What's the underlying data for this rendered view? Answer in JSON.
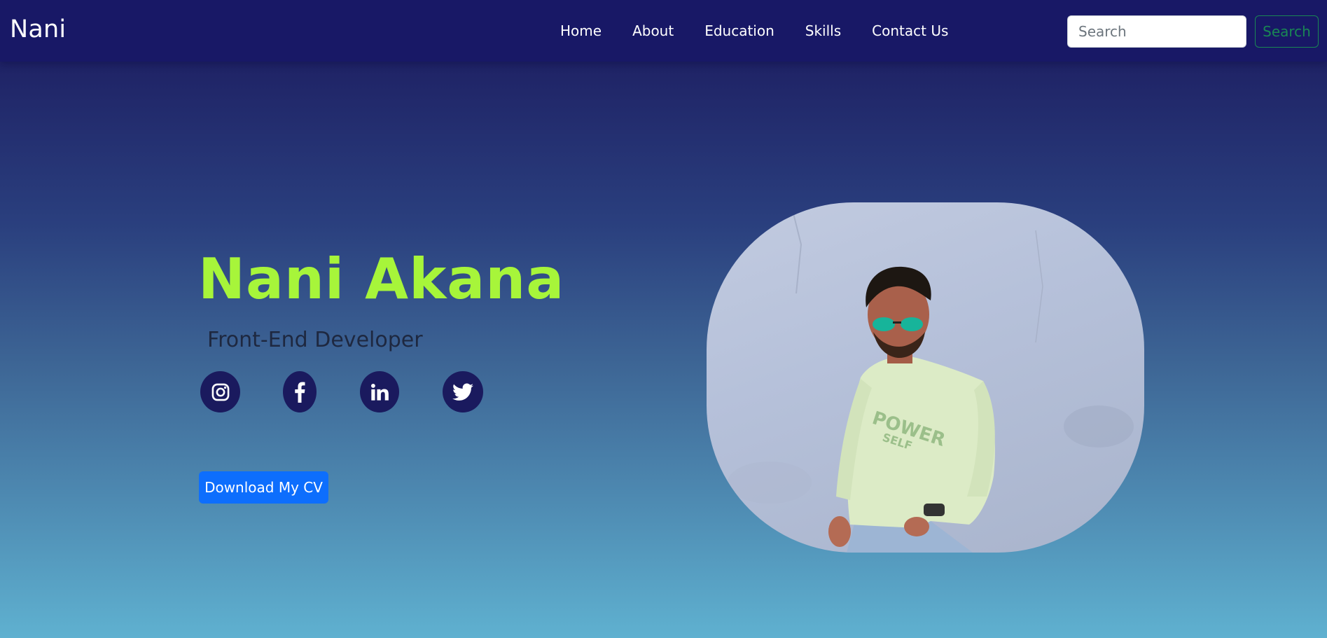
{
  "navbar": {
    "brand": "Nani",
    "links": [
      "Home",
      "About",
      "Education",
      "Skills",
      "Contact Us"
    ],
    "search_placeholder": "Search",
    "search_button": "Search"
  },
  "hero": {
    "name": "Nani Akana",
    "role": "Front-End Developer",
    "cv_button": "Download My CV",
    "social_icons": [
      "instagram-icon",
      "facebook-icon",
      "linkedin-icon",
      "twitter-icon"
    ]
  },
  "colors": {
    "navbar_bg": "#181866",
    "name_color": "#a7f53a",
    "cv_button_bg": "#0d6efd",
    "search_button_color": "#198754",
    "social_bg": "#1a1a5e"
  }
}
